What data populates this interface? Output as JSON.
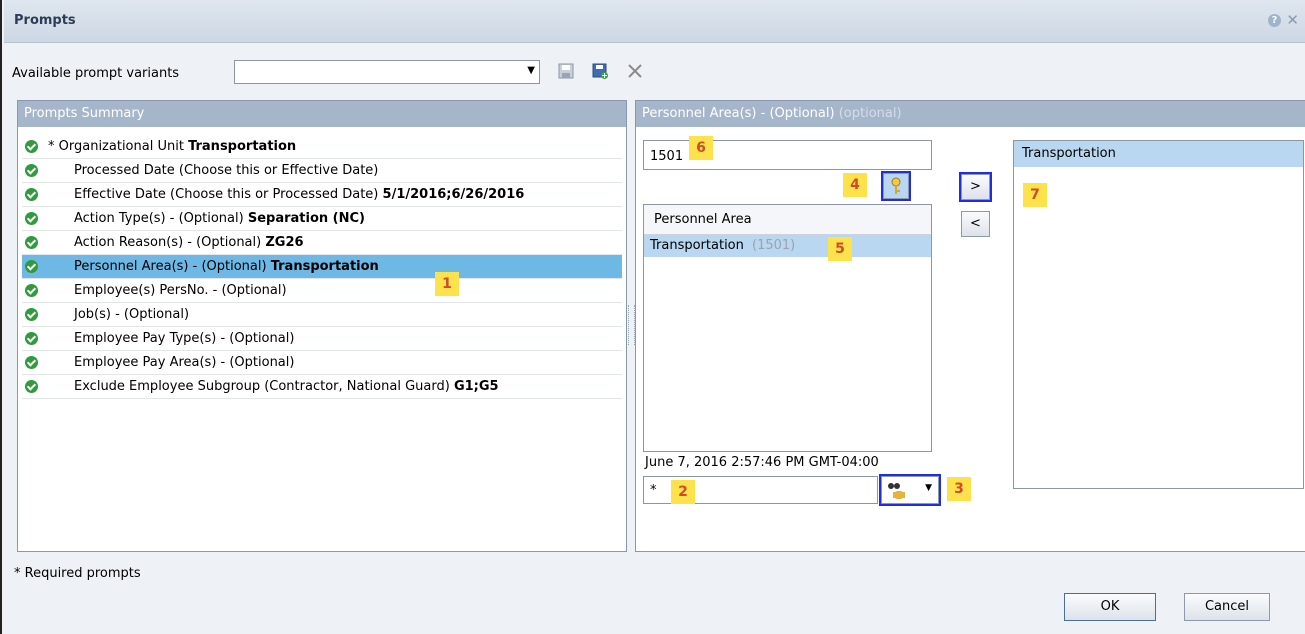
{
  "window": {
    "title": "Prompts",
    "help_glyph": "?",
    "close_glyph": "✕"
  },
  "variants": {
    "label": "Available prompt variants",
    "value": ""
  },
  "summary": {
    "header": "Prompts Summary",
    "rows": [
      {
        "label": "* Organizational Unit",
        "value": "Transportation",
        "selected": false,
        "indent": false
      },
      {
        "label": "Processed Date (Choose this or Effective Date)",
        "value": "",
        "selected": false,
        "indent": true
      },
      {
        "label": "Effective Date (Choose this or Processed Date)",
        "value": "5/1/2016;6/26/2016",
        "selected": false,
        "indent": true
      },
      {
        "label": "Action Type(s) - (Optional)",
        "value": "Separation (NC)",
        "selected": false,
        "indent": true
      },
      {
        "label": "Action Reason(s) - (Optional)",
        "value": "ZG26",
        "selected": false,
        "indent": true
      },
      {
        "label": "Personnel Area(s) - (Optional)",
        "value": "Transportation",
        "selected": true,
        "indent": true
      },
      {
        "label": "Employee(s) PersNo. - (Optional)",
        "value": "",
        "selected": false,
        "indent": true
      },
      {
        "label": "Job(s) - (Optional)",
        "value": "",
        "selected": false,
        "indent": true
      },
      {
        "label": "Employee Pay Type(s) - (Optional)",
        "value": "",
        "selected": false,
        "indent": true
      },
      {
        "label": "Employee Pay Area(s) - (Optional)",
        "value": "",
        "selected": false,
        "indent": true
      },
      {
        "label": "Exclude Employee Subgroup (Contractor, National Guard)",
        "value": "G1;G5",
        "selected": false,
        "indent": true
      }
    ],
    "required_note": "* Required prompts"
  },
  "detail": {
    "header": "Personnel Area(s) - (Optional)",
    "header_suffix": "(optional)",
    "key_input_value": "1501",
    "list_header": "Personnel Area",
    "list_items": [
      {
        "name": "Transportation",
        "key": "(1501)"
      }
    ],
    "timestamp": "June 7, 2016 2:57:46 PM GMT-04:00",
    "search_value": "*",
    "add_label": ">",
    "remove_label": "<",
    "selected_items": [
      "Transportation"
    ]
  },
  "badges": {
    "b1": "1",
    "b2": "2",
    "b3": "3",
    "b4": "4",
    "b5": "5",
    "b6": "6",
    "b7": "7"
  },
  "buttons": {
    "ok": "OK",
    "cancel": "Cancel"
  },
  "colors": {
    "selection": "#6eb8e6",
    "panel_header": "#a6b6ca",
    "badge_bg": "#fde24c",
    "badge_text": "#d14a2a",
    "highlight": "#1e2ee0"
  }
}
